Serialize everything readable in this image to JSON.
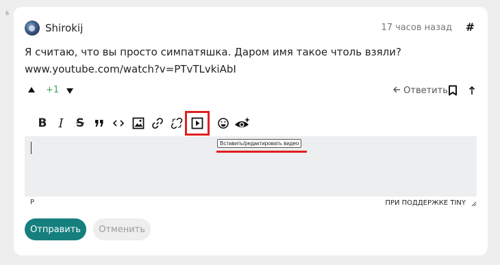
{
  "thread": {
    "level": "6"
  },
  "comment": {
    "author": "Shirokij",
    "time": "17 часов назад",
    "hash": "#",
    "text_line1": "Я считаю, что вы просто симпатяшка. Даром имя такое чтоль взяли?",
    "text_line2": "www.youtube.com/watch?v=PTvTLvkiAbI",
    "votes": "+1",
    "reply_label": "Ответить"
  },
  "toolbar": {
    "bold": "B",
    "italic": "I",
    "strike": "S",
    "quote": "❞",
    "code": "<>",
    "tooltip": "Вставить/редактировать видео",
    "highlight_color": "#e01e1e"
  },
  "editor": {
    "value": "",
    "status_path": "P",
    "brand": "ПРИ ПОДДЕРЖКЕ TINY"
  },
  "actions": {
    "submit": "Отправить",
    "cancel": "Отменить"
  },
  "colors": {
    "accent": "#157f7e",
    "vote_positive": "#3aa35a"
  }
}
